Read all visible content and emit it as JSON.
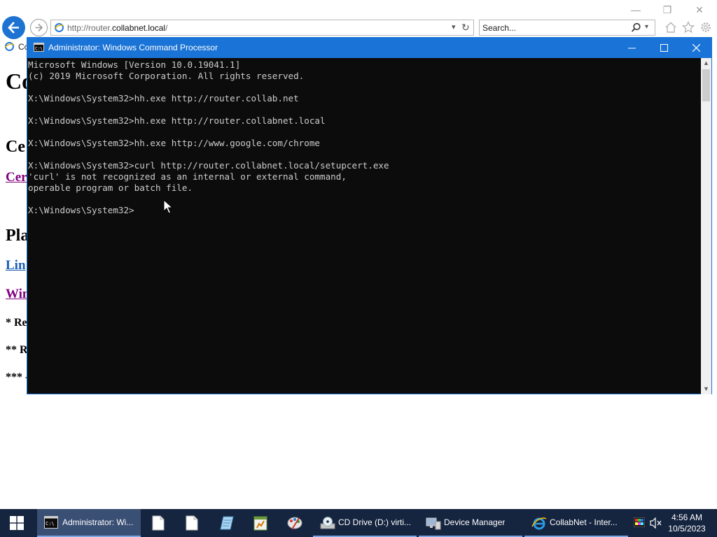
{
  "browser": {
    "address_url_prefix": "http://router.",
    "address_url_domain": "collabnet.local",
    "address_url_suffix": "/",
    "search_placeholder": "Search...",
    "tab_label": "Co"
  },
  "page": {
    "heading": "Co",
    "section_cert": "Ce",
    "link_cert": "Cer",
    "section_platform": "Pla",
    "link_linux": "Lin",
    "link_windows": "Win",
    "note1": "* Re",
    "note2": "** R",
    "note3": "*** -"
  },
  "cmd": {
    "title": "Administrator: Windows Command Processor",
    "lines": [
      "Microsoft Windows [Version 10.0.19041.1]",
      "(c) 2019 Microsoft Corporation. All rights reserved.",
      "",
      "X:\\Windows\\System32>hh.exe http://router.collab.net",
      "",
      "X:\\Windows\\System32>hh.exe http://router.collabnet.local",
      "",
      "X:\\Windows\\System32>hh.exe http://www.google.com/chrome",
      "",
      "X:\\Windows\\System32>curl http://router.collabnet.local/setupcert.exe",
      "'curl' is not recognized as an internal or external command,",
      "operable program or batch file.",
      "",
      "X:\\Windows\\System32>"
    ]
  },
  "taskbar": {
    "items": [
      {
        "label": "Administrator: Wi...",
        "icon": "cmd-icon"
      },
      {
        "label": "",
        "icon": "file-icon"
      },
      {
        "label": "",
        "icon": "file-icon"
      },
      {
        "label": "",
        "icon": "notepad-icon"
      },
      {
        "label": "",
        "icon": "spreadsheet-icon"
      },
      {
        "label": "",
        "icon": "paint-icon"
      },
      {
        "label": "CD Drive (D:) virti...",
        "icon": "cd-drive-icon"
      },
      {
        "label": "Device Manager",
        "icon": "device-manager-icon"
      },
      {
        "label": "CollabNet - Inter...",
        "icon": "ie-icon"
      }
    ],
    "time": "4:56 AM",
    "date": "10/5/2023"
  },
  "colors": {
    "accent": "#1a73d6",
    "console_bg": "#0c0c0c",
    "console_text": "#cccccc",
    "taskbar_bg": "#15243f",
    "link_visited": "#800080",
    "link": "#0000ee"
  }
}
